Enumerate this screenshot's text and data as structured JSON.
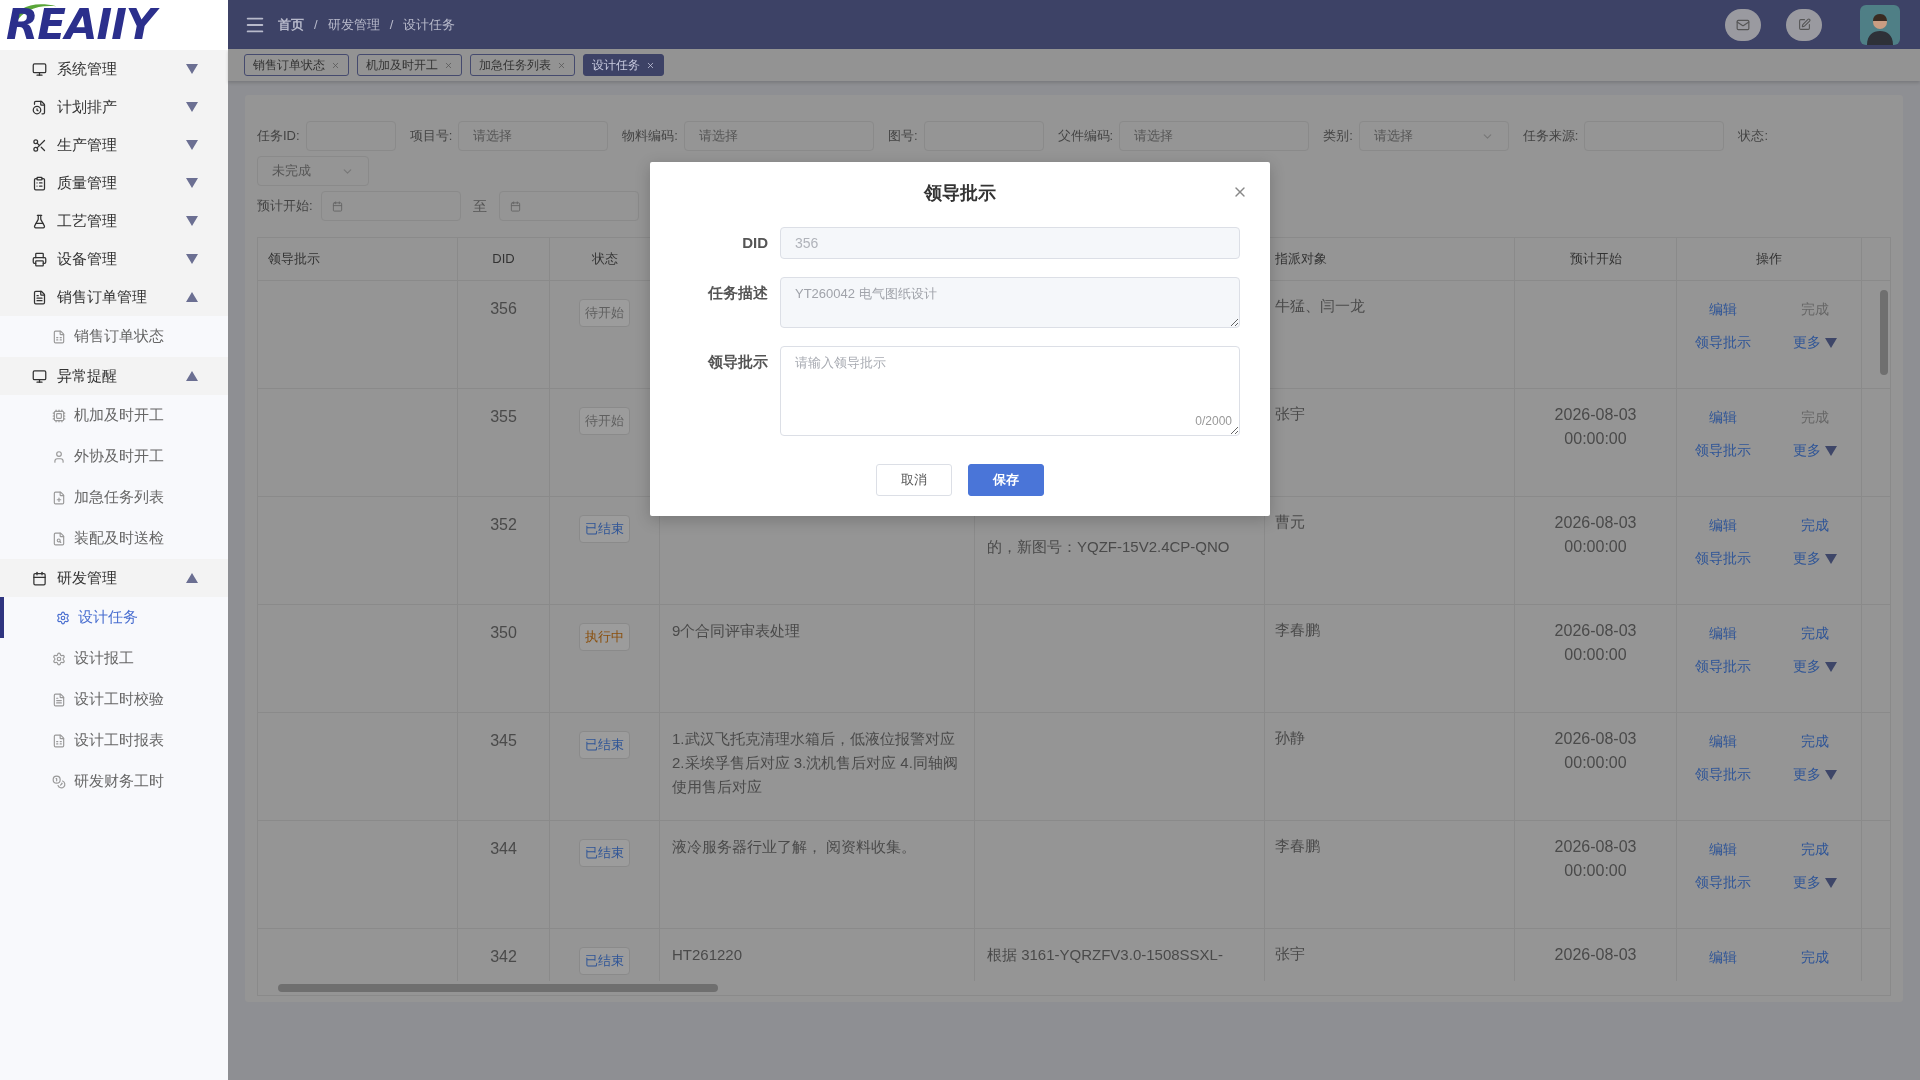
{
  "logo": "REAIIY",
  "sidebar": {
    "groups": [
      {
        "label": "系统管理",
        "expanded": false
      },
      {
        "label": "计划排产",
        "expanded": false
      },
      {
        "label": "生产管理",
        "expanded": false
      },
      {
        "label": "质量管理",
        "expanded": false
      },
      {
        "label": "工艺管理",
        "expanded": false
      },
      {
        "label": "设备管理",
        "expanded": false
      },
      {
        "label": "销售订单管理",
        "expanded": true,
        "children": [
          {
            "label": "销售订单状态",
            "selected": false
          }
        ]
      },
      {
        "label": "异常提醒",
        "expanded": true,
        "children": [
          {
            "label": "机加及时开工",
            "selected": false
          },
          {
            "label": "外协及时开工",
            "selected": false
          },
          {
            "label": "加急任务列表",
            "selected": false
          },
          {
            "label": "装配及时送检",
            "selected": false
          }
        ]
      },
      {
        "label": "研发管理",
        "expanded": true,
        "children": [
          {
            "label": "设计任务",
            "selected": true
          },
          {
            "label": "设计报工",
            "selected": false
          },
          {
            "label": "设计工时校验",
            "selected": false
          },
          {
            "label": "设计工时报表",
            "selected": false
          },
          {
            "label": "研发财务工时",
            "selected": false
          }
        ]
      }
    ]
  },
  "breadcrumb": [
    "首页",
    "/",
    "研发管理",
    "/",
    "设计任务"
  ],
  "tabs": [
    {
      "label": "销售订单状态",
      "selected": false
    },
    {
      "label": "机加及时开工",
      "selected": false
    },
    {
      "label": "加急任务列表",
      "selected": false
    },
    {
      "label": "设计任务",
      "selected": true
    }
  ],
  "filters": [
    {
      "label": "任务ID:",
      "kind": "input"
    },
    {
      "label": "项目号:",
      "kind": "select",
      "placeholder": "请选择"
    },
    {
      "label": "物料编码:",
      "kind": "select",
      "placeholder": "请选择"
    },
    {
      "label": "图号:",
      "kind": "input"
    },
    {
      "label": "父件编码:",
      "kind": "select",
      "placeholder": "请选择"
    },
    {
      "label": "类别:",
      "kind": "dropdown",
      "placeholder": "请选择"
    },
    {
      "label": "任务来源:",
      "kind": "input"
    },
    {
      "label": "状态:",
      "kind": "label"
    }
  ],
  "status_filter": {
    "value": "未完成"
  },
  "date_filter": {
    "label": "预计开始:",
    "separator": "至"
  },
  "table": {
    "columns": [
      "领导批示",
      "DID",
      "状态",
      "",
      "",
      "指派对象",
      "预计开始",
      "操作"
    ],
    "rows": [
      {
        "did": "356",
        "status": "待开始",
        "color": "#606060",
        "desc": "",
        "desc2": "",
        "assignee": "牛猛、闫一龙",
        "start": "",
        "actions": [
          {
            "label": "编辑",
            "disabled": false
          },
          {
            "label": "完成",
            "disabled": true
          },
          {
            "label": "领导批示",
            "disabled": false
          },
          {
            "label": "更多",
            "disabled": false
          }
        ]
      },
      {
        "did": "355",
        "status": "待开始",
        "color": "#606060",
        "desc": "",
        "desc2": "",
        "assignee": "张宇",
        "start": "2026-08-03 00:00:00",
        "actions": [
          {
            "label": "编辑",
            "disabled": false
          },
          {
            "label": "完成",
            "disabled": true
          },
          {
            "label": "领导批示",
            "disabled": false
          },
          {
            "label": "更多",
            "disabled": false
          }
        ]
      },
      {
        "did": "352",
        "status": "已结束",
        "color": "#2f5597",
        "desc": "",
        "desc2": "的，新图号：YQZF-15V2.4CP-QNO",
        "desc2_first_line_hidden": true,
        "assignee": "曹元",
        "start": "2026-08-03 00:00:00",
        "actions": [
          {
            "label": "编辑",
            "disabled": false
          },
          {
            "label": "完成",
            "disabled": false
          },
          {
            "label": "领导批示",
            "disabled": false
          },
          {
            "label": "更多",
            "disabled": false
          }
        ]
      },
      {
        "did": "350",
        "status": "执行中",
        "color": "#8a4f0c",
        "desc": "9个合同评审表处理",
        "desc2": "",
        "assignee": "李春鹏",
        "start": "2026-08-03 00:00:00",
        "actions": [
          {
            "label": "编辑",
            "disabled": false
          },
          {
            "label": "完成",
            "disabled": false
          },
          {
            "label": "领导批示",
            "disabled": false
          },
          {
            "label": "更多",
            "disabled": false
          }
        ]
      },
      {
        "did": "345",
        "status": "已结束",
        "color": "#2f5597",
        "desc": "1.武汉飞托克清理水箱后，低液位报警对应 2.采埃孚售后对应 3.沈机售后对应 4.同轴阀使用售后对应",
        "desc2": "",
        "assignee": "孙静",
        "start": "2026-08-03 00:00:00",
        "actions": [
          {
            "label": "编辑",
            "disabled": false
          },
          {
            "label": "完成",
            "disabled": false
          },
          {
            "label": "领导批示",
            "disabled": false
          },
          {
            "label": "更多",
            "disabled": false
          }
        ]
      },
      {
        "did": "344",
        "status": "已结束",
        "color": "#2f5597",
        "desc": "液冷服务器行业了解， 阅资料收集。",
        "desc2": "",
        "assignee": "李春鹏",
        "start": "2026-08-03 00:00:00",
        "actions": [
          {
            "label": "编辑",
            "disabled": false
          },
          {
            "label": "完成",
            "disabled": false
          },
          {
            "label": "领导批示",
            "disabled": false
          },
          {
            "label": "更多",
            "disabled": false
          }
        ]
      },
      {
        "did": "342",
        "status": "已结束",
        "color": "#2f5597",
        "desc": "HT261220",
        "desc2": "根据 3161-YQRZFV3.0-1508SSXL-",
        "assignee": "张宇",
        "start": "2026-08-03",
        "actions": [
          {
            "label": "编辑",
            "disabled": false
          },
          {
            "label": "完成",
            "disabled": false
          }
        ]
      }
    ]
  },
  "dialog": {
    "title": "领导批示",
    "fields": [
      {
        "label": "DID",
        "kind": "input",
        "value": "356",
        "disabled": true
      },
      {
        "label": "任务描述",
        "kind": "textarea",
        "value": "YT260042 电气图纸设计",
        "disabled": true
      },
      {
        "label": "领导批示",
        "kind": "textarea",
        "placeholder": "请输入领导批示",
        "counter": "0/2000"
      }
    ],
    "buttons": [
      {
        "label": "取消",
        "primary": false
      },
      {
        "label": "保存",
        "primary": true
      }
    ]
  }
}
